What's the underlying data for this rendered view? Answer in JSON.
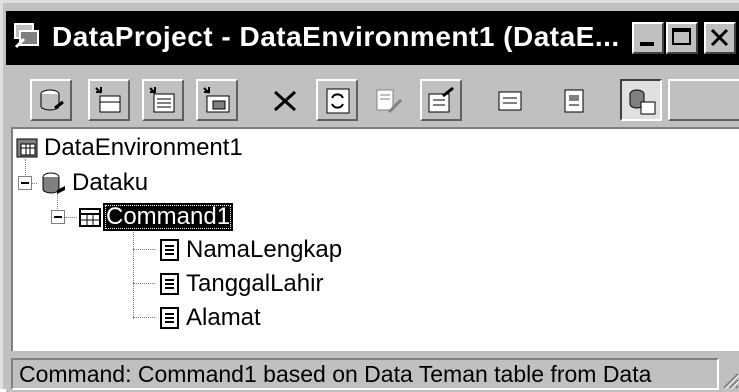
{
  "window": {
    "title": "DataProject - DataEnvironment1 (DataE...",
    "buttons": {
      "minimize": "minimize",
      "maximize": "maximize",
      "close": "close"
    }
  },
  "toolbar": {
    "buttons": [
      "add-connection-icon",
      "add-command-icon",
      "insert-stored-procedure-icon",
      "add-child-command-icon",
      "delete-icon",
      "refresh-icon",
      "design-icon",
      "properties-icon",
      "view-code-icon",
      "options-icon",
      "arrange-by-connection-icon"
    ]
  },
  "tree": {
    "root": {
      "label": "DataEnvironment1"
    },
    "connection": {
      "label": "Dataku"
    },
    "command": {
      "label": "Command1"
    },
    "fields": [
      {
        "label": "NamaLengkap"
      },
      {
        "label": "TanggalLahir"
      },
      {
        "label": "Alamat"
      }
    ]
  },
  "status": {
    "text": "Command:  Command1 based on Data Teman  table  from Data"
  }
}
